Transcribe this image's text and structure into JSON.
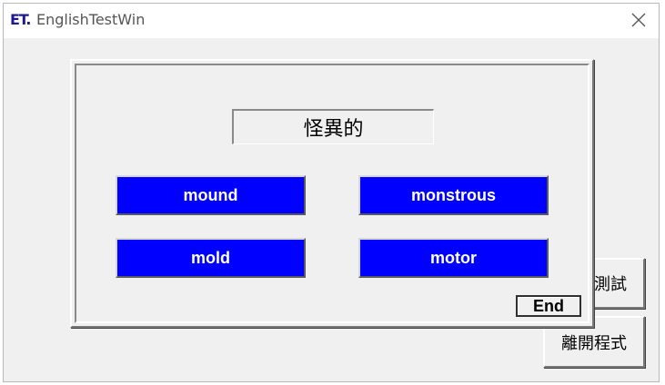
{
  "window": {
    "logo_text": "ET",
    "logo_dot": ".",
    "title": "EnglishTestWin"
  },
  "main": {
    "test_button_label": "測試",
    "exit_button_label": "離開程式"
  },
  "quiz": {
    "question": "怪異的",
    "answers": [
      "mound",
      "monstrous",
      "mold",
      "motor"
    ],
    "end_label": "End"
  },
  "colors": {
    "answer_bg": "#0000ff",
    "answer_text": "#ffffff",
    "window_bg": "#f0f0f0",
    "logo": "#1e1a8c"
  }
}
